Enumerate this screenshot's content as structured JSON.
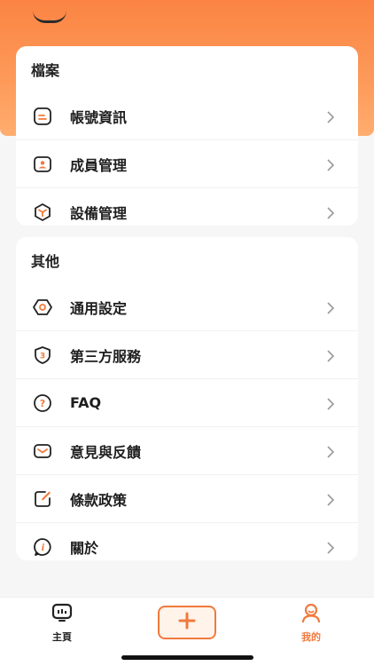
{
  "section_files": {
    "title": "檔案",
    "items": [
      {
        "label": "帳號資訊",
        "icon": "account-info-icon"
      },
      {
        "label": "成員管理",
        "icon": "member-icon"
      },
      {
        "label": "設備管理",
        "icon": "device-icon"
      }
    ]
  },
  "section_other": {
    "title": "其他",
    "items": [
      {
        "label": "通用設定",
        "icon": "settings-icon"
      },
      {
        "label": "第三方服務",
        "icon": "third-party-icon"
      },
      {
        "label": "FAQ",
        "icon": "faq-icon"
      },
      {
        "label": "意見與反饋",
        "icon": "feedback-icon"
      },
      {
        "label": "條款政策",
        "icon": "terms-icon"
      },
      {
        "label": "關於",
        "icon": "about-icon"
      }
    ]
  },
  "tabbar": {
    "home_label": "主頁",
    "mine_label": "我的"
  },
  "colors": {
    "accent": "#f07a3d",
    "header_top": "#fb8443",
    "header_bottom": "#ffad6f"
  }
}
